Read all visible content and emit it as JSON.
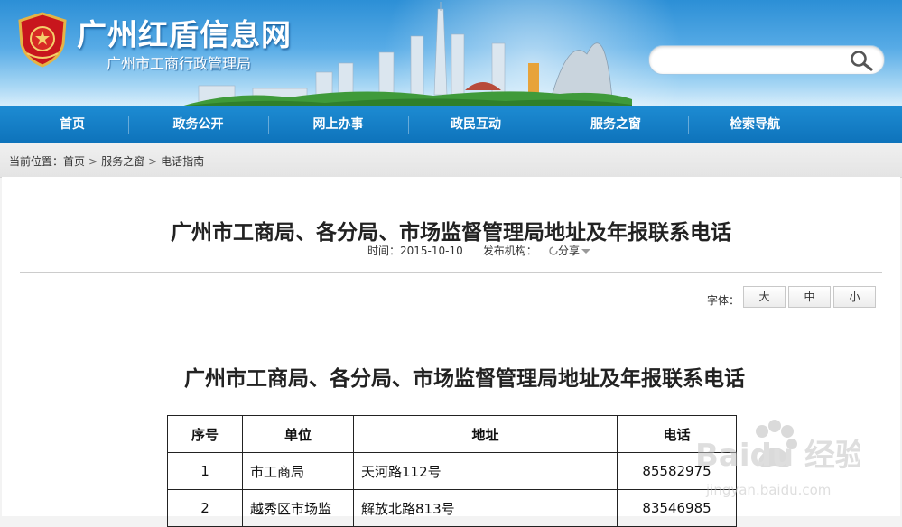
{
  "header": {
    "site_title": "广州红盾信息网",
    "site_subtitle": "广州市工商行政管理局",
    "search_placeholder": ""
  },
  "nav": {
    "items": [
      "首页",
      "政务公开",
      "网上办事",
      "政民互动",
      "服务之窗",
      "检索导航"
    ]
  },
  "breadcrumb": {
    "prefix": "当前位置：",
    "items": [
      "首页",
      "服务之窗",
      "电话指南"
    ],
    "separator": ">"
  },
  "article": {
    "title": "广州市工商局、各分局、市场监督管理局地址及年报联系电话",
    "time_label": "时间：",
    "time_value": "2015-10-10",
    "publisher_label": "发布机构：",
    "share_label": "分享",
    "font_label": "字体：",
    "font_sizes": [
      "大",
      "中",
      "小"
    ],
    "subtitle": "广州市工商局、各分局、市场监督管理局地址及年报联系电话"
  },
  "table": {
    "headers": [
      "序号",
      "单位",
      "地址",
      "电话"
    ],
    "rows": [
      [
        "1",
        "市工商局",
        "天河路112号",
        "85582975"
      ],
      [
        "2",
        "越秀区市场监",
        "解放北路813号",
        "83546985"
      ]
    ]
  },
  "watermark": {
    "brand": "Baidu 经验",
    "url": "jingyan.baidu.com"
  },
  "colors": {
    "nav_bg": "#1380c8",
    "banner_top": "#2c8fd6"
  }
}
